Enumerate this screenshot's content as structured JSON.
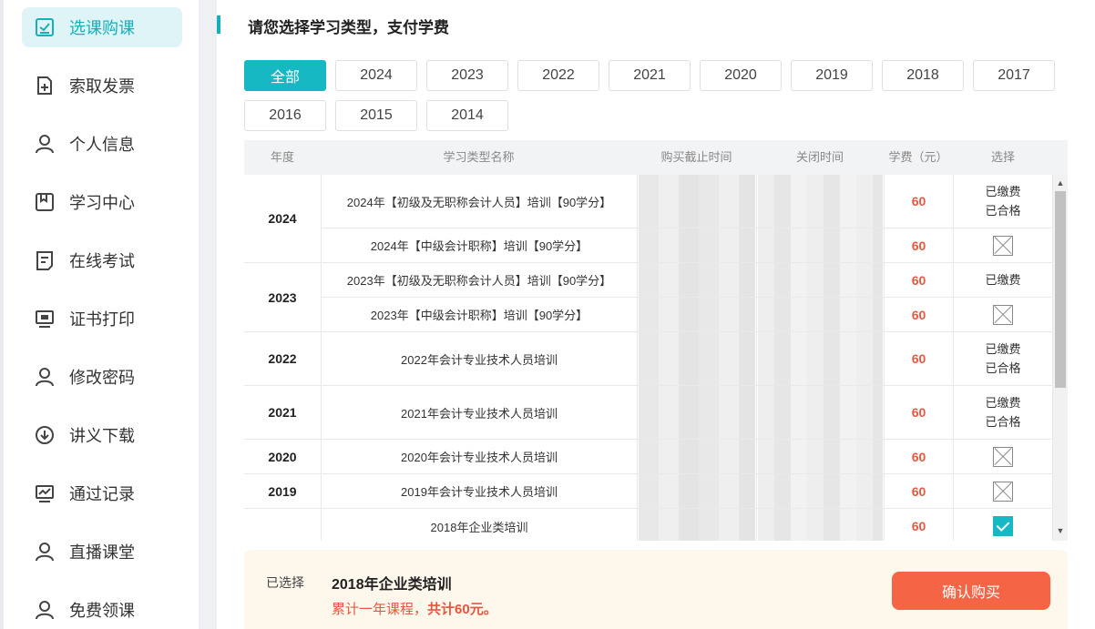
{
  "sidebar": {
    "items": [
      {
        "label": "选课购课",
        "icon": "checkbox-icon"
      },
      {
        "label": "索取发票",
        "icon": "invoice-icon"
      },
      {
        "label": "个人信息",
        "icon": "user-icon"
      },
      {
        "label": "学习中心",
        "icon": "book-icon"
      },
      {
        "label": "在线考试",
        "icon": "exam-icon"
      },
      {
        "label": "证书打印",
        "icon": "monitor-icon"
      },
      {
        "label": "修改密码",
        "icon": "user-icon"
      },
      {
        "label": "讲义下载",
        "icon": "download-icon"
      },
      {
        "label": "通过记录",
        "icon": "chart-icon"
      },
      {
        "label": "直播课堂",
        "icon": "user-icon"
      },
      {
        "label": "免费领课",
        "icon": "user-icon"
      }
    ]
  },
  "page": {
    "title": "请您选择学习类型，支付学费"
  },
  "filters": [
    "全部",
    "2024",
    "2023",
    "2022",
    "2021",
    "2020",
    "2019",
    "2018",
    "2017",
    "2016",
    "2015",
    "2014"
  ],
  "table": {
    "headers": [
      "年度",
      "学习类型名称",
      "购买截止时间",
      "关闭时间",
      "学费（元）",
      "选择"
    ],
    "years": [
      "2024",
      "2023",
      "2022",
      "2021",
      "2020",
      "2019",
      "2018"
    ],
    "rows": [
      {
        "name": "2024年【初级及无职称会计人员】培训【90学分】",
        "price": "60",
        "status": [
          "已缴费",
          "已合格"
        ]
      },
      {
        "name": "2024年【中级会计职称】培训【90学分】",
        "price": "60",
        "status": []
      },
      {
        "name": "2023年【初级及无职称会计人员】培训【90学分】",
        "price": "60",
        "status": [
          "已缴费"
        ]
      },
      {
        "name": "2023年【中级会计职称】培训【90学分】",
        "price": "60",
        "status": []
      },
      {
        "name": "2022年会计专业技术人员培训",
        "price": "60",
        "status": [
          "已缴费",
          "已合格"
        ]
      },
      {
        "name": "2021年会计专业技术人员培训",
        "price": "60",
        "status": [
          "已缴费",
          "已合格"
        ]
      },
      {
        "name": "2020年会计专业技术人员培训",
        "price": "60",
        "status": []
      },
      {
        "name": "2019年会计专业技术人员培训",
        "price": "60",
        "status": []
      },
      {
        "name": "2018年企业类培训",
        "price": "60",
        "status": []
      }
    ]
  },
  "selection": {
    "label": "已选择",
    "name": "2018年企业类培训",
    "summary_prefix": "累计一年课程，",
    "summary_total": "共计60元。",
    "confirm_label": "确认购买"
  },
  "colors": {
    "accent": "#16b8c4",
    "price": "#e8563f",
    "buy": "#f46445"
  }
}
